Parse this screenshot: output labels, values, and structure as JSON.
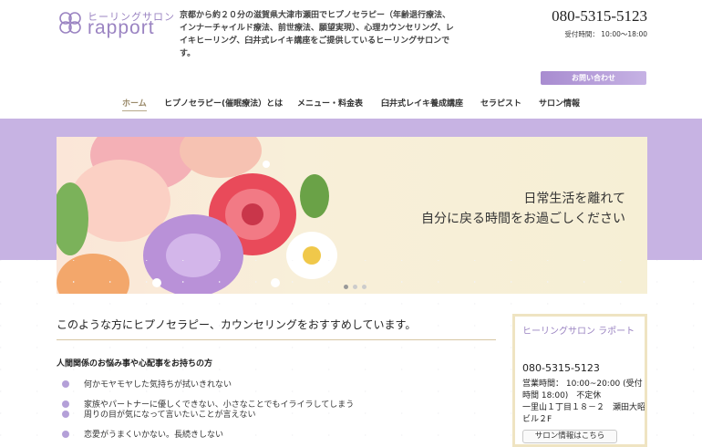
{
  "header": {
    "logo_small": "ヒーリングサロン",
    "logo_big": "rapport",
    "intro": "京都から約２０分の滋賀県大津市瀬田でヒプノセラピー（年齢退行療法、インナーチャイルド療法、前世療法、願望実現）、心理カウンセリング、レイキヒーリング、臼井式レイキ講座をご提供しているヒーリングサロンです。",
    "phone": "080-5315-5123",
    "hours": "受付時間： 10:00～18:00",
    "contact_label": "お問い合わせ"
  },
  "nav": {
    "items": [
      {
        "label": "ホーム",
        "active": true
      },
      {
        "label": "ヒプノセラピー(催眠療法）とは"
      },
      {
        "label": "メニュー・料金表"
      },
      {
        "label": "臼井式レイキ養成講座"
      },
      {
        "label": "セラピスト"
      },
      {
        "label": "サロン情報"
      }
    ]
  },
  "hero": {
    "line1": "日常生活を離れて",
    "line2": "自分に戻る時間をお過ごしください",
    "slide_count": 3,
    "active_slide": 0
  },
  "main": {
    "title": "このような方にヒプノセラピー、カウンセリングをおすすめしています。",
    "subtitle": "人間関係のお悩み事や心配事をお持ちの方",
    "items": [
      "何かモヤモヤした気持ちが拭いきれない",
      "家族やパートナーに優しくできない、小さなことでもイライラしてしまう",
      "周りの目が気になって言いたいことが言えない",
      "恋愛がうまくいかない。長続きしない"
    ]
  },
  "sidebar": {
    "title": "ヒーリングサロン ラポート",
    "phone": "080-5315-5123",
    "hours": "営業時間： 10:00~20:00 (受付時間 18:00)　不定休",
    "address": "一里山１丁目１８－２　瀬田大昭ビル２F",
    "button_label": "サロン情報はこちら"
  },
  "colors": {
    "accent": "#9b84c2",
    "band": "#c7b3e3",
    "gold_line": "#d8c7a4"
  }
}
